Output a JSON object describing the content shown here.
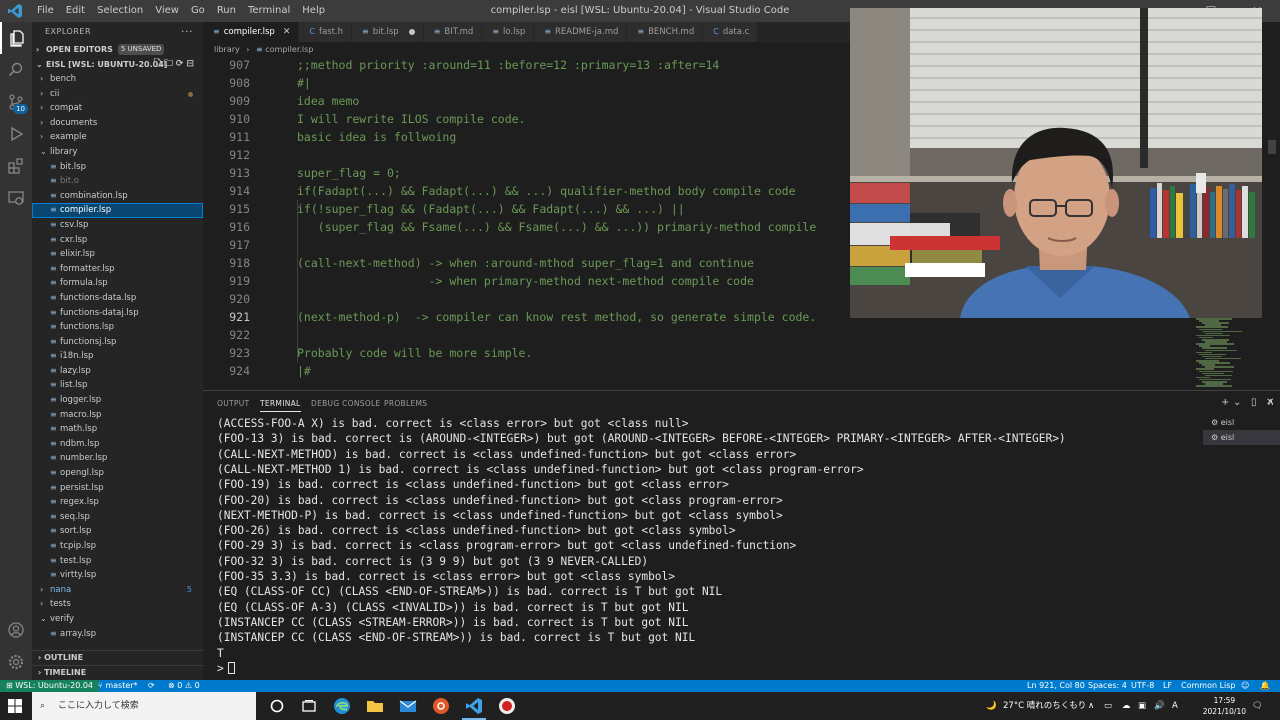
{
  "window": {
    "menu": [
      "File",
      "Edit",
      "Selection",
      "View",
      "Go",
      "Run",
      "Terminal",
      "Help"
    ],
    "title": "compiler.lsp - eisl [WSL: Ubuntu-20.04] - Visual Studio Code",
    "controls": {
      "minimize": "—",
      "maximize": "☐",
      "close": "✕"
    }
  },
  "sidebar": {
    "title": "EXPLORER",
    "more": "···",
    "open_editors_label": "OPEN EDITORS",
    "unsaved_badge": "5 UNSAVED",
    "workspace_label": "EISL [WSL: UBUNTU-20.04]",
    "items": [
      {
        "label": "bench",
        "kind": "folder",
        "depth": 1
      },
      {
        "label": "cii",
        "kind": "folder",
        "depth": 1,
        "modified": true
      },
      {
        "label": "compat",
        "kind": "folder",
        "depth": 1
      },
      {
        "label": "documents",
        "kind": "folder",
        "depth": 1
      },
      {
        "label": "example",
        "kind": "folder",
        "depth": 1
      },
      {
        "label": "library",
        "kind": "folder-open",
        "depth": 1
      },
      {
        "label": "bit.lsp",
        "kind": "file",
        "depth": 2
      },
      {
        "label": "bit.o",
        "kind": "file-dim",
        "depth": 2
      },
      {
        "label": "combination.lsp",
        "kind": "file",
        "depth": 2
      },
      {
        "label": "compiler.lsp",
        "kind": "file-selected",
        "depth": 2
      },
      {
        "label": "csv.lsp",
        "kind": "file",
        "depth": 2
      },
      {
        "label": "cxr.lsp",
        "kind": "file",
        "depth": 2
      },
      {
        "label": "elixir.lsp",
        "kind": "file",
        "depth": 2
      },
      {
        "label": "formatter.lsp",
        "kind": "file",
        "depth": 2
      },
      {
        "label": "formula.lsp",
        "kind": "file",
        "depth": 2
      },
      {
        "label": "functions-data.lsp",
        "kind": "file",
        "depth": 2
      },
      {
        "label": "functions-dataj.lsp",
        "kind": "file",
        "depth": 2
      },
      {
        "label": "functions.lsp",
        "kind": "file",
        "depth": 2
      },
      {
        "label": "functionsj.lsp",
        "kind": "file",
        "depth": 2
      },
      {
        "label": "i18n.lsp",
        "kind": "file",
        "depth": 2
      },
      {
        "label": "lazy.lsp",
        "kind": "file",
        "depth": 2
      },
      {
        "label": "list.lsp",
        "kind": "file",
        "depth": 2
      },
      {
        "label": "logger.lsp",
        "kind": "file",
        "depth": 2
      },
      {
        "label": "macro.lsp",
        "kind": "file",
        "depth": 2
      },
      {
        "label": "math.lsp",
        "kind": "file",
        "depth": 2
      },
      {
        "label": "ndbm.lsp",
        "kind": "file",
        "depth": 2
      },
      {
        "label": "number.lsp",
        "kind": "file",
        "depth": 2
      },
      {
        "label": "opengl.lsp",
        "kind": "file",
        "depth": 2
      },
      {
        "label": "persist.lsp",
        "kind": "file",
        "depth": 2
      },
      {
        "label": "regex.lsp",
        "kind": "file",
        "depth": 2
      },
      {
        "label": "seq.lsp",
        "kind": "file",
        "depth": 2
      },
      {
        "label": "sort.lsp",
        "kind": "file",
        "depth": 2
      },
      {
        "label": "tcpip.lsp",
        "kind": "file",
        "depth": 2
      },
      {
        "label": "test.lsp",
        "kind": "file",
        "depth": 2
      },
      {
        "label": "virtty.lsp",
        "kind": "file",
        "depth": 2
      },
      {
        "label": "nana",
        "kind": "folder-blue",
        "depth": 1,
        "badge": "5"
      },
      {
        "label": "tests",
        "kind": "folder",
        "depth": 1
      },
      {
        "label": "verify",
        "kind": "folder-open",
        "depth": 1
      },
      {
        "label": "array.lsp",
        "kind": "file",
        "depth": 2
      }
    ],
    "outline_label": "OUTLINE",
    "timeline_label": "TIMELINE"
  },
  "tabs": [
    {
      "label": "compiler.lsp",
      "active": true,
      "icon": "≡",
      "close": "✕"
    },
    {
      "label": "fast.h",
      "icon": "C"
    },
    {
      "label": "bit.lsp",
      "icon": "≡",
      "dirty": true
    },
    {
      "label": "BIT.md",
      "icon": "≡"
    },
    {
      "label": "lo.lsp",
      "icon": "≡"
    },
    {
      "label": "README-ja.md",
      "icon": "≡"
    },
    {
      "label": "BENCH.md",
      "icon": "≡"
    },
    {
      "label": "data.c",
      "icon": "C"
    }
  ],
  "breadcrumb": {
    "folder": "library",
    "sep": "›",
    "file": "compiler.lsp"
  },
  "editor": {
    "current_line": "921",
    "lines": [
      {
        "n": "907",
        "t": ";;method priority :around=11 :before=12 :primary=13 :after=14"
      },
      {
        "n": "908",
        "t": "#|"
      },
      {
        "n": "909",
        "t": "idea memo"
      },
      {
        "n": "910",
        "t": "I will rewrite ILOS compile code."
      },
      {
        "n": "911",
        "t": "basic idea is follwoing"
      },
      {
        "n": "912",
        "t": ""
      },
      {
        "n": "913",
        "t": "super_flag = 0;"
      },
      {
        "n": "914",
        "t": "if(Fadapt(...) && Fadapt(...) && ...) qualifier-method body compile code"
      },
      {
        "n": "915",
        "t": "if(!super_flag && (Fadapt(...) && Fadapt(...) && ...) ||"
      },
      {
        "n": "916",
        "t": "   (super_flag && Fsame(...) && Fsame(...) && ...)) primariy-method compile"
      },
      {
        "n": "917",
        "t": ""
      },
      {
        "n": "918",
        "t": "(call-next-method) -> when :around-mthod super_flag=1 and continue"
      },
      {
        "n": "919",
        "t": "                   -> when primary-method next-method compile code"
      },
      {
        "n": "920",
        "t": ""
      },
      {
        "n": "921",
        "t": "(next-method-p)  -> compiler can know rest method, so generate simple code."
      },
      {
        "n": "922",
        "t": ""
      },
      {
        "n": "923",
        "t": "Probably code will be more simple."
      },
      {
        "n": "924",
        "t": "|#"
      }
    ]
  },
  "panel": {
    "tabs": [
      "OUTPUT",
      "TERMINAL",
      "DEBUG CONSOLE",
      "PROBLEMS"
    ],
    "active_tab": "TERMINAL",
    "controls": [
      "+",
      "⌄",
      "▯",
      "∧",
      "✕"
    ],
    "terminals": [
      "eisl",
      "eisl"
    ],
    "terminal_lines": [
      "(ACCESS-FOO-A X) is bad. correct is <class error> but got <class null>",
      "(FOO-13 3) is bad. correct is (AROUND-<INTEGER>) but got (AROUND-<INTEGER> BEFORE-<INTEGER> PRIMARY-<INTEGER> AFTER-<INTEGER>)",
      "(CALL-NEXT-METHOD) is bad. correct is <class undefined-function> but got <class error>",
      "(CALL-NEXT-METHOD 1) is bad. correct is <class undefined-function> but got <class program-error>",
      "(FOO-19) is bad. correct is <class undefined-function> but got <class error>",
      "(FOO-20) is bad. correct is <class undefined-function> but got <class program-error>",
      "(NEXT-METHOD-P) is bad. correct is <class undefined-function> but got <class symbol>",
      "(FOO-26) is bad. correct is <class undefined-function> but got <class symbol>",
      "(FOO-29 3) is bad. correct is <class program-error> but got <class undefined-function>",
      "(FOO-32 3) is bad. correct is (3 9 9) but got (3 9 NEVER-CALLED)",
      "(FOO-35 3.3) is bad. correct is <class error> but got <class symbol>",
      "(EQ (CLASS-OF CC) (CLASS <END-OF-STREAM>)) is bad. correct is T but got NIL",
      "(EQ (CLASS-OF A-3) (CLASS <INVALID>)) is bad. correct is T but got NIL",
      "(INSTANCEP CC (CLASS <STREAM-ERROR>)) is bad. correct is T but got NIL",
      "(INSTANCEP CC (CLASS <END-OF-STREAM>)) is bad. correct is T but got NIL",
      "T"
    ],
    "prompt": ">"
  },
  "statusbar": {
    "remote": "WSL: Ubuntu-20.04",
    "branch": "master*",
    "sync": "⟳",
    "problems": "⊗ 0 ⚠ 0",
    "position": "Ln 921, Col 80",
    "spaces": "Spaces: 4",
    "encoding": "UTF-8",
    "eol": "LF",
    "language": "Common Lisp"
  },
  "taskbar": {
    "search_placeholder": "ここに入力して検索",
    "weather": "27°C  晴れのちくもり",
    "ime": "A",
    "time": "17:59",
    "date": "2021/10/10"
  },
  "colors": {
    "comment": "#6a9955",
    "accent": "#007acc",
    "remote": "#16825d"
  }
}
